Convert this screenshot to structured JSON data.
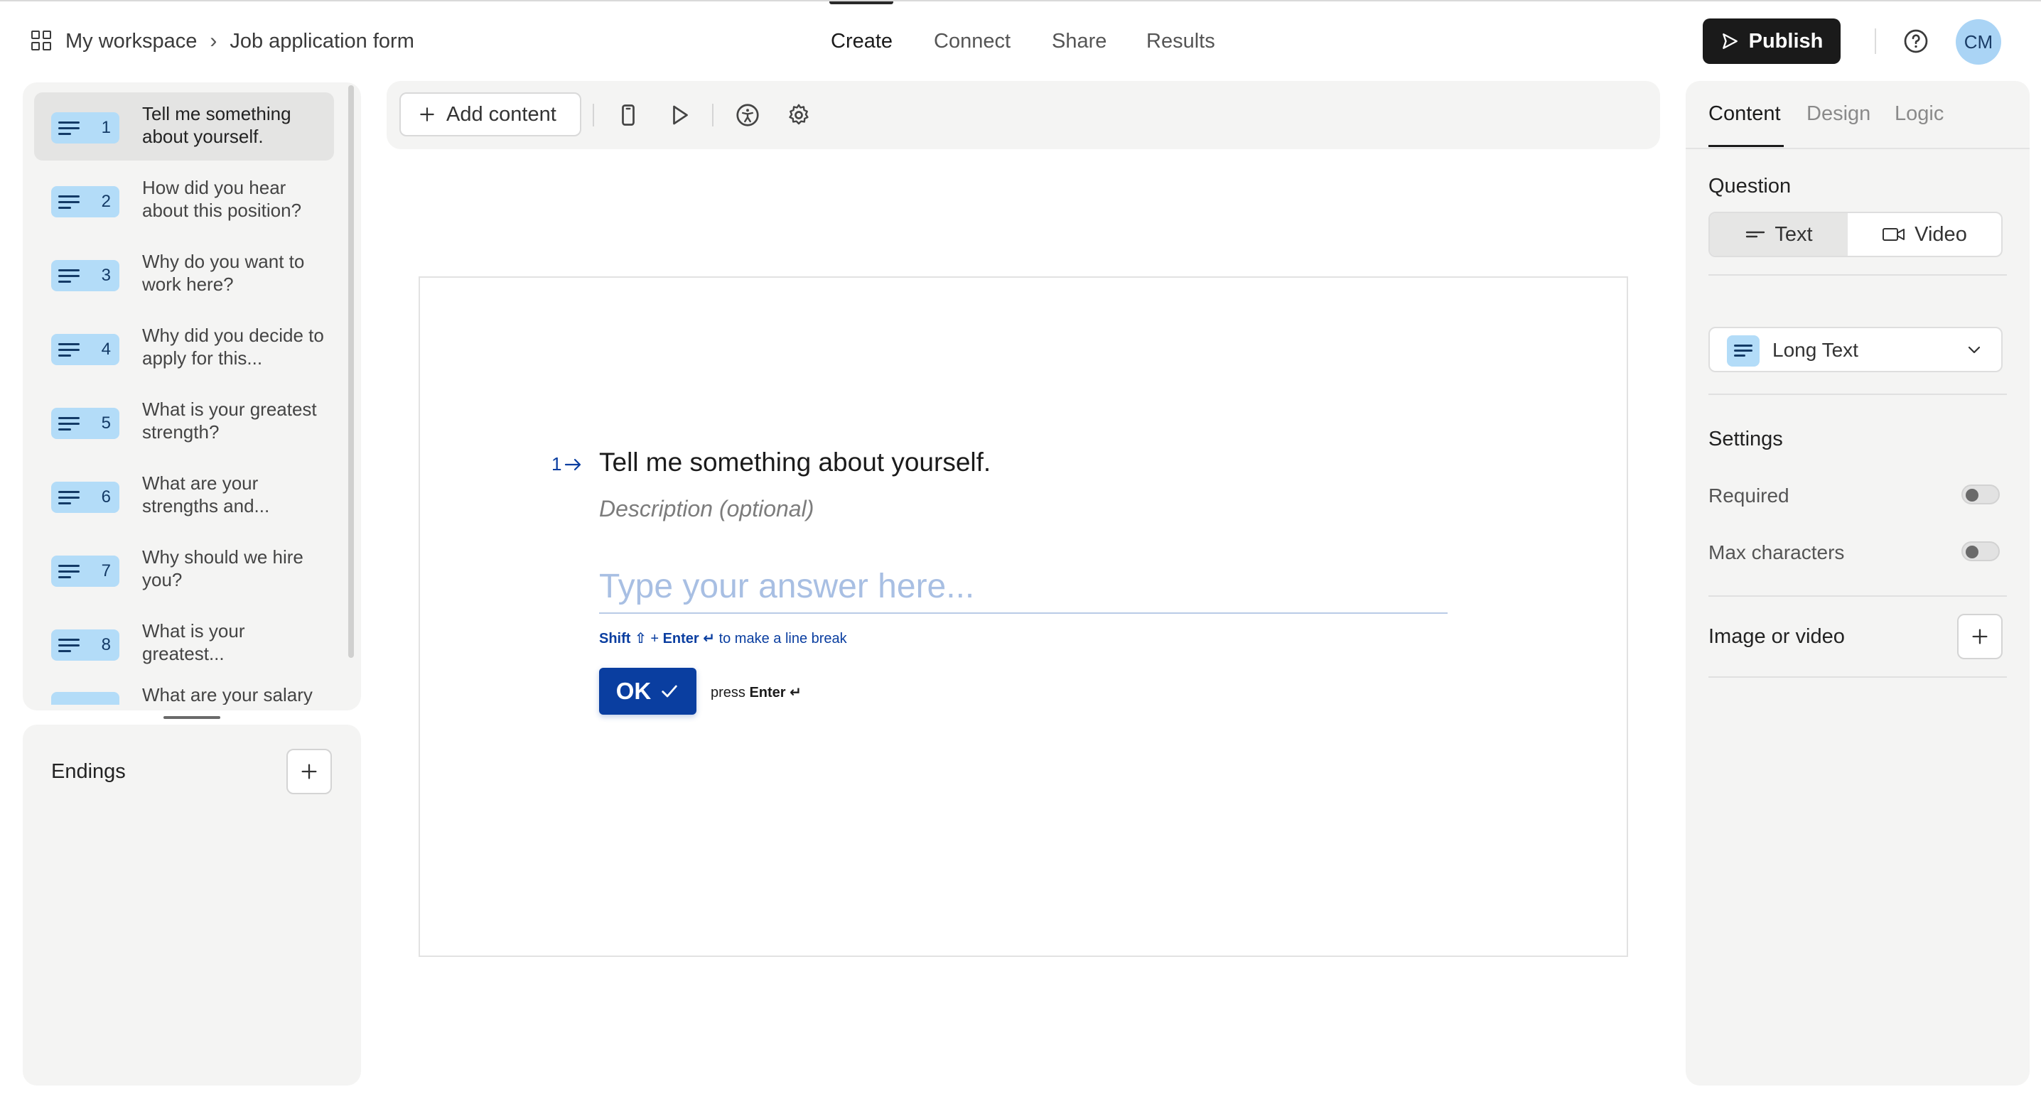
{
  "header": {
    "breadcrumb": {
      "workspace": "My workspace",
      "separator": "›",
      "form": "Job application form"
    },
    "nav": [
      {
        "label": "Create",
        "active": true
      },
      {
        "label": "Connect",
        "active": false
      },
      {
        "label": "Share",
        "active": false
      },
      {
        "label": "Results",
        "active": false
      }
    ],
    "publish_label": "Publish",
    "avatar_initials": "CM"
  },
  "questions": [
    {
      "number": "1",
      "text": "Tell me something about yourself.",
      "active": true
    },
    {
      "number": "2",
      "text": "How did you hear about this position?"
    },
    {
      "number": "3",
      "text": "Why do you want to work here?"
    },
    {
      "number": "4",
      "text": "Why did you decide to apply for this..."
    },
    {
      "number": "5",
      "text": "What is your greatest strength?"
    },
    {
      "number": "6",
      "text": "What are your strengths and..."
    },
    {
      "number": "7",
      "text": "Why should we hire you?"
    },
    {
      "number": "8",
      "text": "What is your greatest..."
    },
    {
      "number": "",
      "text": "What are your salary"
    }
  ],
  "endings": {
    "title": "Endings"
  },
  "toolbar": {
    "add_content_label": "Add content"
  },
  "canvas": {
    "question_number": "1",
    "question_title": "Tell me something about yourself.",
    "description_placeholder": "Description (optional)",
    "answer_placeholder": "Type your answer here...",
    "hint": {
      "shift": "Shift ⇧",
      "plus": "+",
      "enter": "Enter ↵",
      "rest": "to make a line break"
    },
    "ok_label": "OK",
    "press_label": "press",
    "press_key": "Enter ↵"
  },
  "right_panel": {
    "tabs": [
      {
        "label": "Content",
        "active": true
      },
      {
        "label": "Design"
      },
      {
        "label": "Logic"
      }
    ],
    "question_label": "Question",
    "segments": {
      "text": "Text",
      "video": "Video",
      "selected": "Text"
    },
    "question_type": "Long Text",
    "settings_label": "Settings",
    "settings": [
      {
        "label": "Required",
        "on": false
      },
      {
        "label": "Max characters",
        "on": false
      }
    ],
    "image_or_video_label": "Image or video"
  },
  "colors": {
    "brand_blue": "#0a3ea0",
    "badge_blue": "#b3dcf8",
    "panel_bg": "#f4f4f3",
    "publish_bg": "#1a1a1a"
  }
}
